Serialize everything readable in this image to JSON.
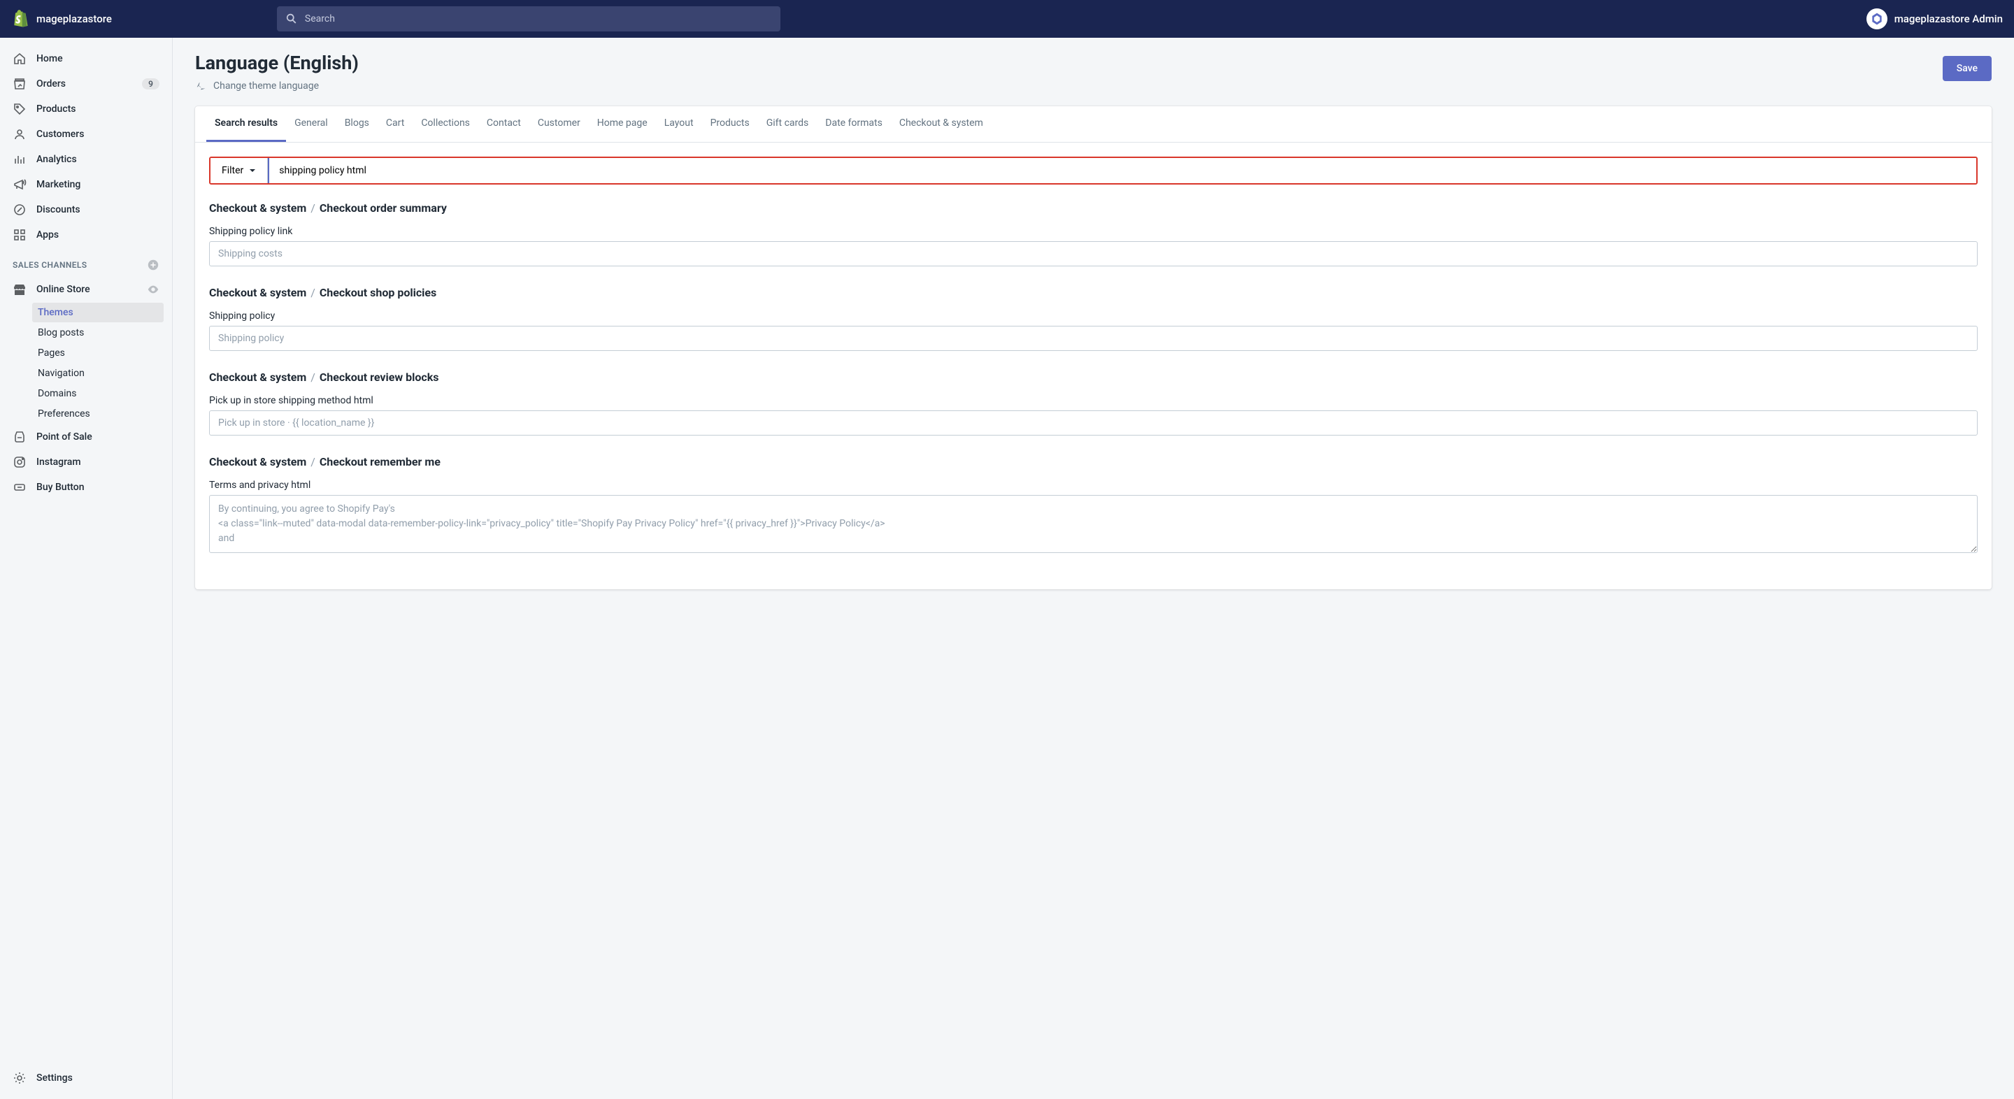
{
  "topbar": {
    "store_name": "mageplazastore",
    "search_placeholder": "Search",
    "user_name": "mageplazastore Admin"
  },
  "sidebar": {
    "items": [
      {
        "label": "Home"
      },
      {
        "label": "Orders",
        "badge": "9"
      },
      {
        "label": "Products"
      },
      {
        "label": "Customers"
      },
      {
        "label": "Analytics"
      },
      {
        "label": "Marketing"
      },
      {
        "label": "Discounts"
      },
      {
        "label": "Apps"
      }
    ],
    "section_title": "SALES CHANNELS",
    "channels": [
      {
        "label": "Online Store",
        "subitems": [
          {
            "label": "Themes",
            "active": true
          },
          {
            "label": "Blog posts"
          },
          {
            "label": "Pages"
          },
          {
            "label": "Navigation"
          },
          {
            "label": "Domains"
          },
          {
            "label": "Preferences"
          }
        ]
      },
      {
        "label": "Point of Sale"
      },
      {
        "label": "Instagram"
      },
      {
        "label": "Buy Button"
      }
    ],
    "settings_label": "Settings"
  },
  "page": {
    "title": "Language (English)",
    "subtitle": "Change theme language",
    "save_label": "Save"
  },
  "tabs": [
    "Search results",
    "General",
    "Blogs",
    "Cart",
    "Collections",
    "Contact",
    "Customer",
    "Home page",
    "Layout",
    "Products",
    "Gift cards",
    "Date formats",
    "Checkout & system"
  ],
  "filter": {
    "button_label": "Filter",
    "input_value": "shipping policy html"
  },
  "sections": [
    {
      "heading_a": "Checkout & system",
      "heading_b": "Checkout order summary",
      "field_label": "Shipping policy link",
      "placeholder": "Shipping costs",
      "value": ""
    },
    {
      "heading_a": "Checkout & system",
      "heading_b": "Checkout shop policies",
      "field_label": "Shipping policy",
      "placeholder": "Shipping policy",
      "value": ""
    },
    {
      "heading_a": "Checkout & system",
      "heading_b": "Checkout review blocks",
      "field_label": "Pick up in store shipping method html",
      "placeholder": "Pick up in store · {{ location_name }}",
      "value": ""
    },
    {
      "heading_a": "Checkout & system",
      "heading_b": "Checkout remember me",
      "field_label": "Terms and privacy html",
      "placeholder": "By continuing, you agree to Shopify Pay's\n<a class=\"link--muted\" data-modal data-remember-policy-link=\"privacy_policy\" title=\"Shopify Pay Privacy Policy\" href=\"{{ privacy_href }}\">Privacy Policy</a>\nand",
      "value": "",
      "textarea": true
    }
  ]
}
